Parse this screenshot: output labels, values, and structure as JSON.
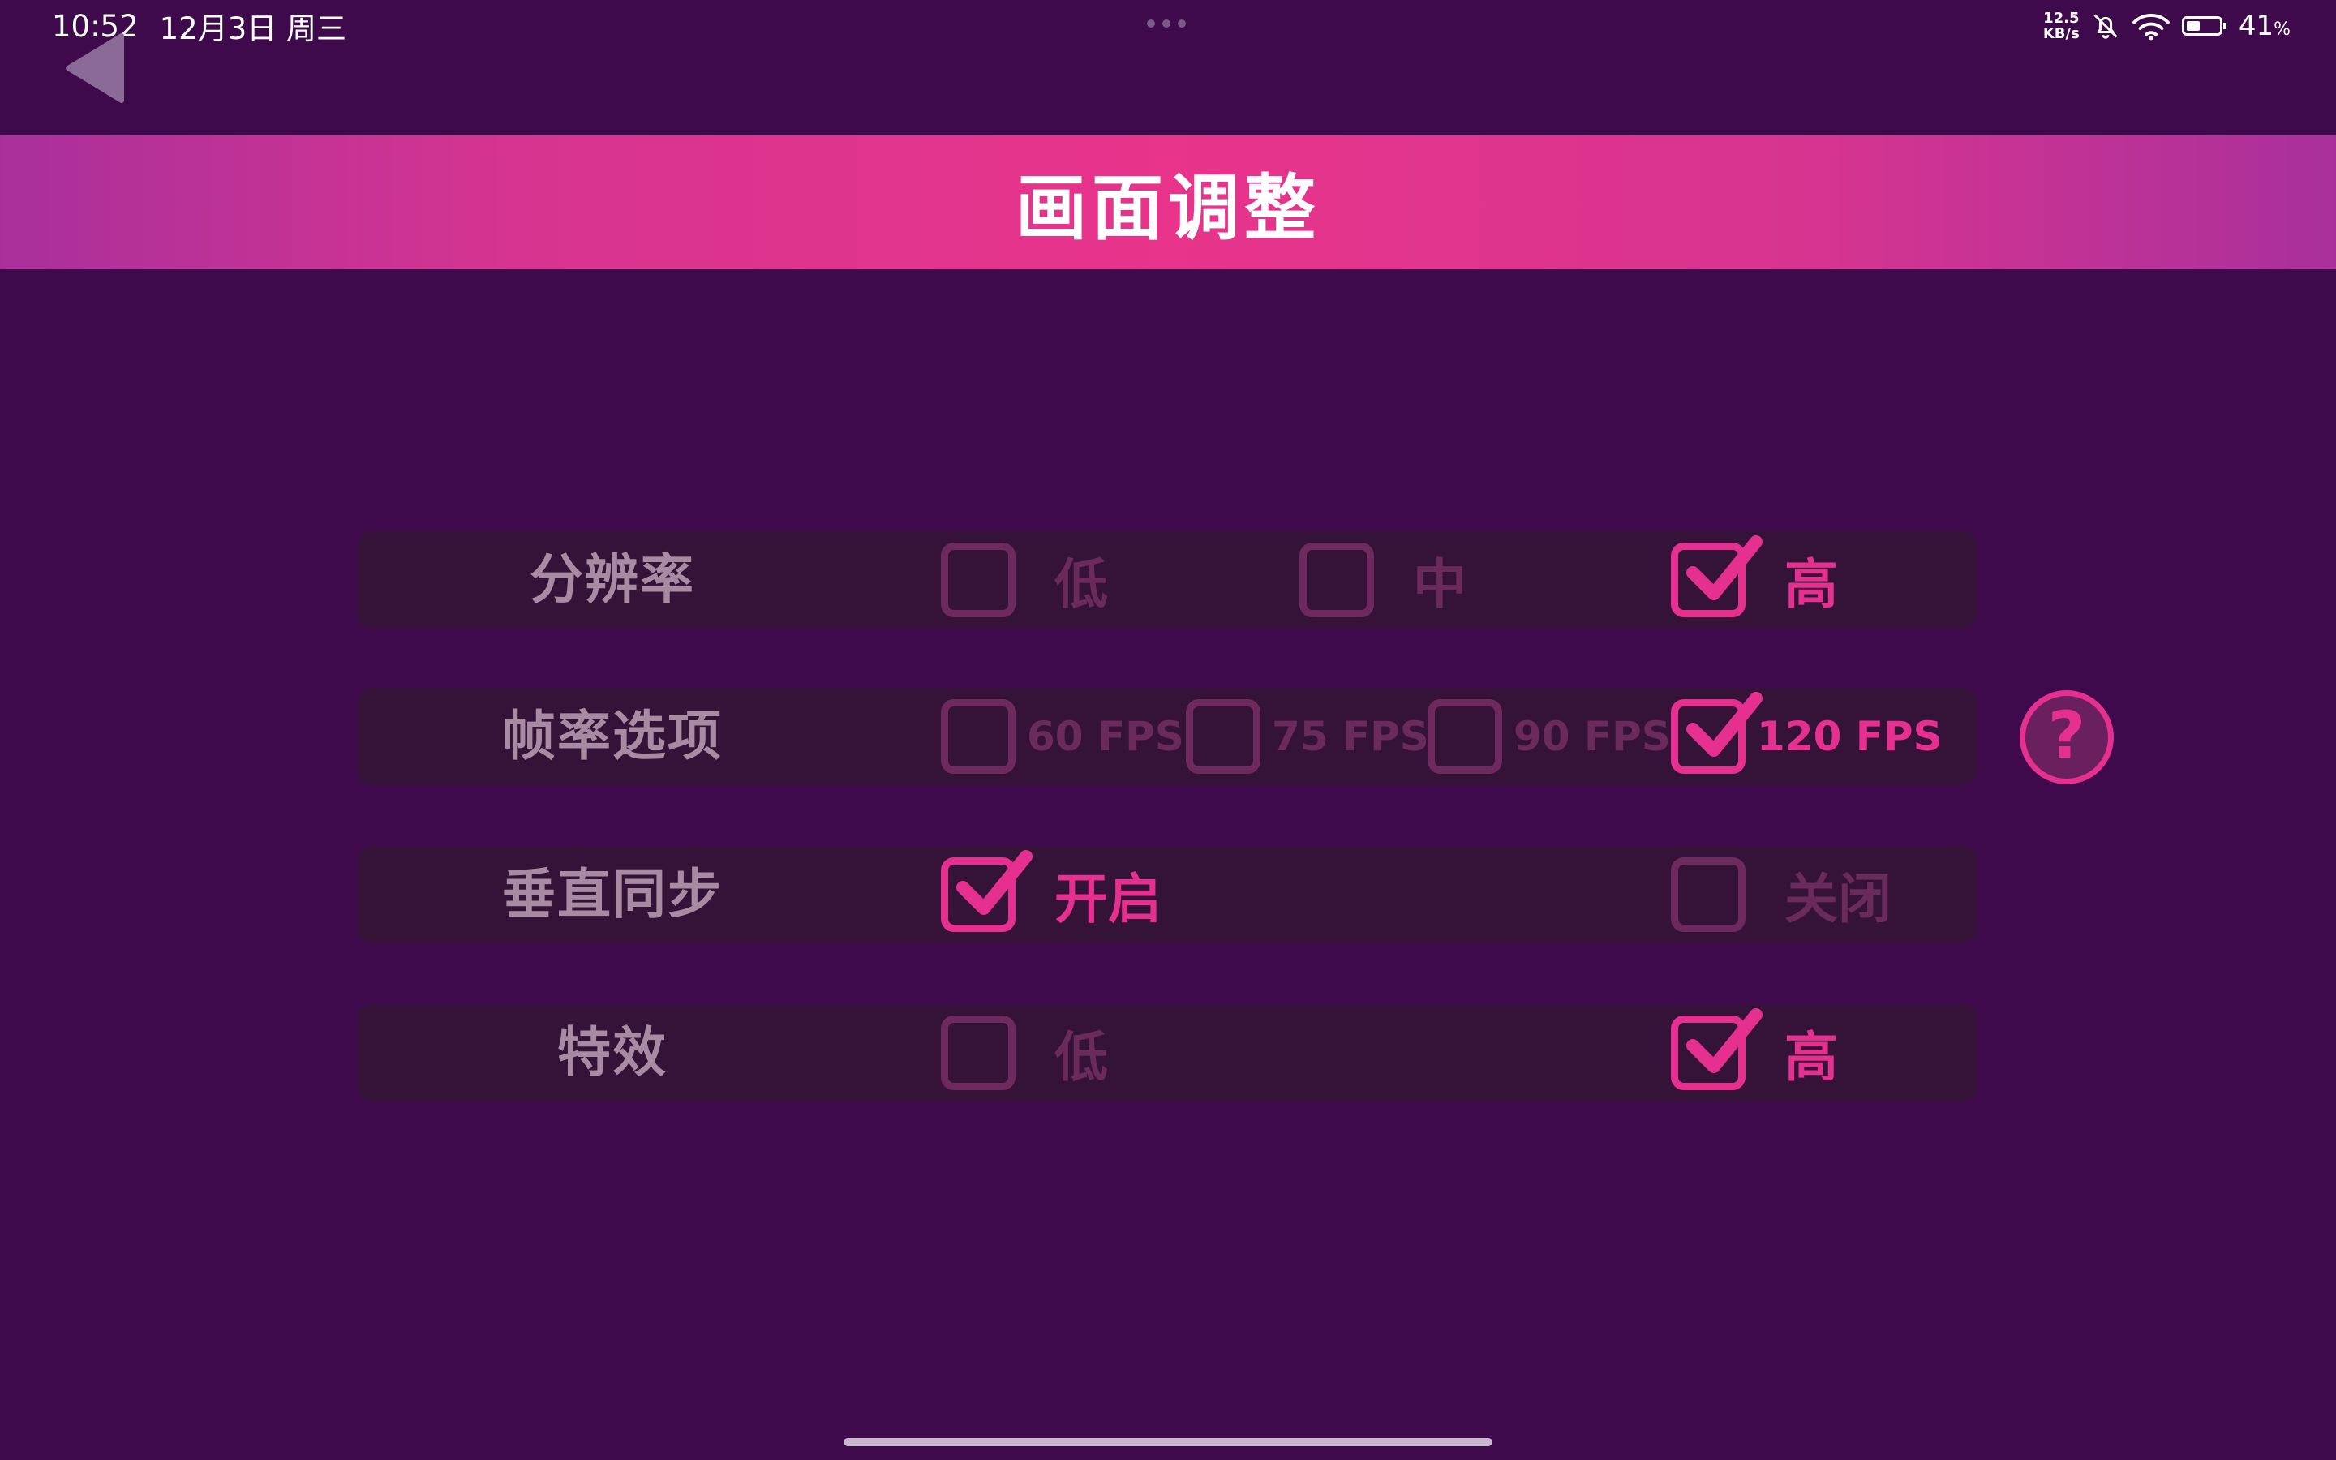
{
  "status_bar": {
    "time": "10:52",
    "date": "12月3日 周三",
    "net_speed_value": "12.5",
    "net_speed_unit": "KB/s",
    "battery_percent": "41",
    "battery_percent_sign": "%",
    "icons": [
      "bell-off-icon",
      "wifi-icon",
      "battery-icon"
    ]
  },
  "header": {
    "title": "画面调整",
    "back_icon": "back-triangle-icon"
  },
  "colors": {
    "background": "#3e0a4b",
    "accent": "#e5308f",
    "row_background": "#351339",
    "inactive": "#6e2a5e",
    "label": "#a98aa3"
  },
  "settings": [
    {
      "label": "分辨率",
      "options": [
        {
          "label": "低",
          "checked": false
        },
        {
          "label": "中",
          "checked": false
        },
        {
          "label": "高",
          "checked": true
        }
      ]
    },
    {
      "label": "帧率选项",
      "options": [
        {
          "label": "60 FPS",
          "checked": false
        },
        {
          "label": "75 FPS",
          "checked": false
        },
        {
          "label": "90 FPS",
          "checked": false
        },
        {
          "label": "120 FPS",
          "checked": true
        }
      ]
    },
    {
      "label": "垂直同步",
      "options": [
        {
          "label": "开启",
          "checked": true
        },
        {
          "label": "关闭",
          "checked": false
        }
      ]
    },
    {
      "label": "特效",
      "options": [
        {
          "label": "低",
          "checked": false
        },
        {
          "label": "高",
          "checked": true
        }
      ]
    }
  ],
  "help": {
    "symbol": "?",
    "icon": "question-mark-icon"
  }
}
